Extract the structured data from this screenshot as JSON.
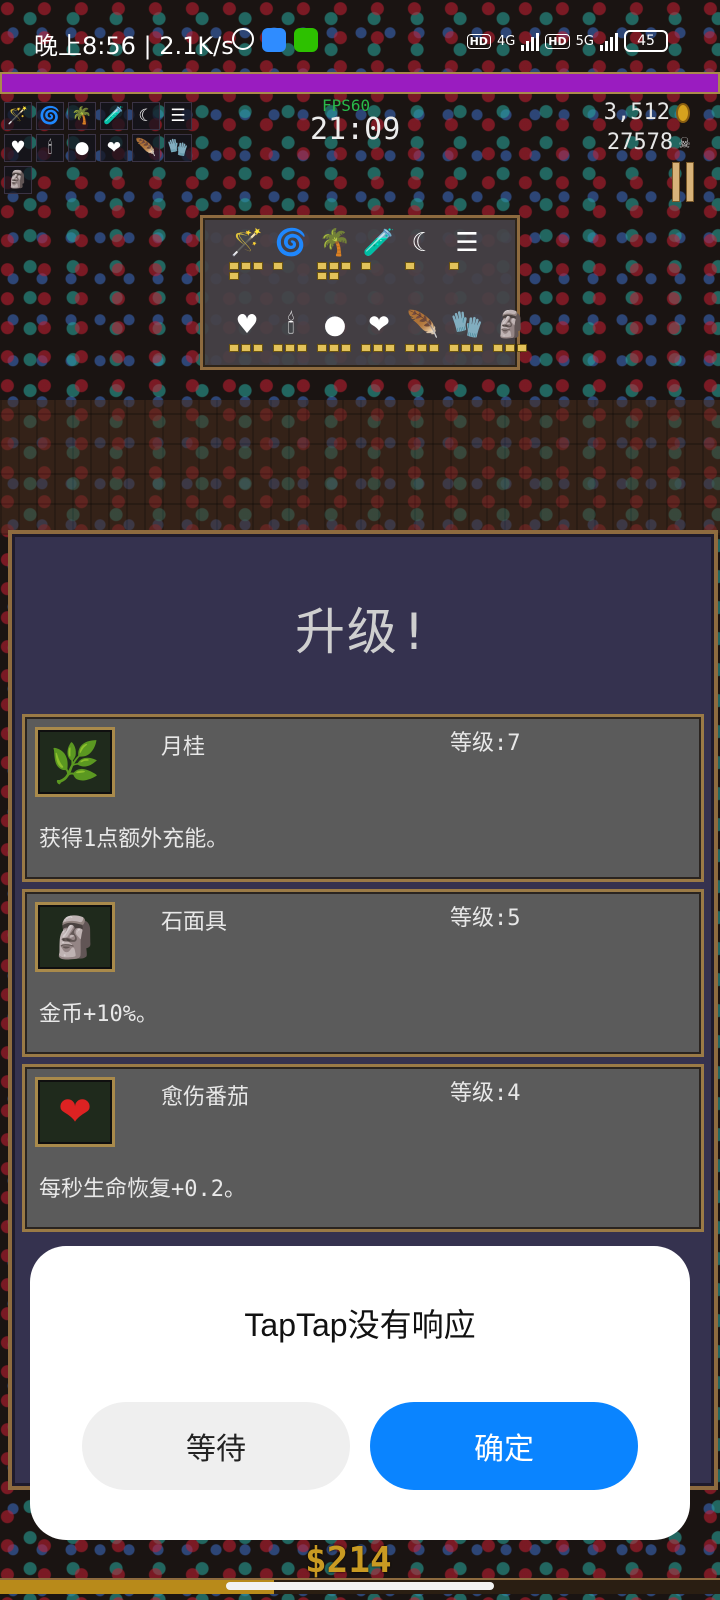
{
  "status_bar": {
    "time_speed": "晚上8:56 | 2.1K/s",
    "network_1": "4G",
    "network_2": "5G",
    "hd": "HD",
    "battery": "45"
  },
  "hud": {
    "xp_fill_fraction": 1.0,
    "fps": "FPS60",
    "timer": "21:09",
    "gold": "3,512",
    "kills": "27578",
    "weapon_slots": [
      "blue-wand-icon",
      "crimson-whip-icon",
      "green-palm-icon",
      "potion-icon",
      "sickle-icon",
      "scroll-icon"
    ],
    "passive_slots": [
      "black-heart-icon",
      "candelabra-icon",
      "blue-orb-icon",
      "red-heart-icon",
      "feather-icon",
      "gauntlet-icon"
    ],
    "extra_slots": [
      "stone-mask-icon"
    ]
  },
  "inventory": {
    "weapons": [
      {
        "icon": "🪄",
        "name": "blue-wand-icon",
        "pips": 4
      },
      {
        "icon": "🌀",
        "name": "crimson-whip-icon",
        "pips": 1
      },
      {
        "icon": "🌴",
        "name": "green-palm-icon",
        "pips": 5
      },
      {
        "icon": "🧪",
        "name": "potion-icon",
        "pips": 1
      },
      {
        "icon": "☾",
        "name": "sickle-icon",
        "pips": 1
      },
      {
        "icon": "☰",
        "name": "scroll-icon",
        "pips": 1
      }
    ],
    "passives": [
      {
        "icon": "♥",
        "name": "black-heart-icon",
        "pips": 3
      },
      {
        "icon": "🕯",
        "name": "candelabra-icon",
        "pips": 3
      },
      {
        "icon": "●",
        "name": "blue-orb-icon",
        "pips": 3
      },
      {
        "icon": "❤",
        "name": "red-heart-icon",
        "pips": 3
      },
      {
        "icon": "🪶",
        "name": "feather-icon",
        "pips": 3
      },
      {
        "icon": "🧤",
        "name": "gauntlet-icon",
        "pips": 3
      },
      {
        "icon": "🗿",
        "name": "stone-mask-icon",
        "pips": 3
      }
    ]
  },
  "levelup": {
    "title": "升级!",
    "options": [
      {
        "icon": "🌿",
        "name": "月桂",
        "level": "等级:7",
        "desc": "获得1点额外充能。"
      },
      {
        "icon": "🗿",
        "name": "石面具",
        "level": "等级:5",
        "desc": "金币+10%。"
      },
      {
        "icon": "❤",
        "name": "愈伤番茄",
        "level": "等级:4",
        "desc": "每秒生命恢复+0.2。"
      }
    ]
  },
  "bottom": {
    "gold": "$214"
  },
  "dialog": {
    "title": "TapTap没有响应",
    "wait_label": "等待",
    "ok_label": "确定",
    "ok_color": "#0a84ff"
  }
}
